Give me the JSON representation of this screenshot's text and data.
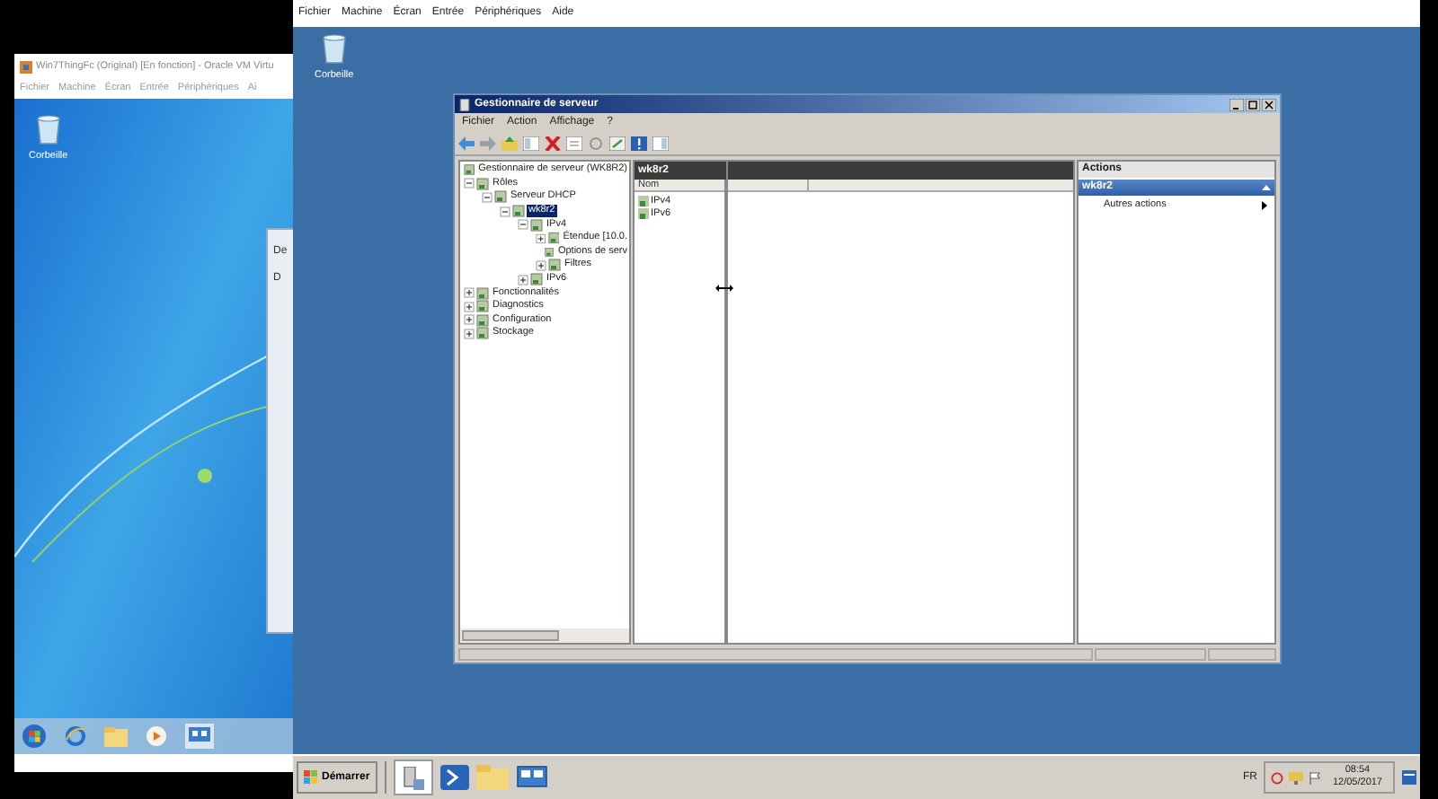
{
  "left_vm": {
    "title": "Win7ThingFc (Original) [En fonction] - Oracle VM Virtu",
    "menu": [
      "Fichier",
      "Machine",
      "Écran",
      "Entrée",
      "Périphériques",
      "Ai"
    ],
    "desktop_icons": [
      {
        "label": "Corbeille"
      }
    ],
    "dialog": {
      "texts": [
        "De",
        "D"
      ]
    }
  },
  "right_vm": {
    "menu": [
      "Fichier",
      "Machine",
      "Écran",
      "Entrée",
      "Périphériques",
      "Aide"
    ],
    "desktop_icons": [
      {
        "label": "Corbeille"
      }
    ],
    "taskbar": {
      "start": "Démarrer",
      "language": "FR",
      "time": "08:54",
      "date": "12/05/2017"
    }
  },
  "server_manager": {
    "title": "Gestionnaire de serveur",
    "menu": [
      "Fichier",
      "Action",
      "Affichage",
      "?"
    ],
    "tree": [
      {
        "label": "Gestionnaire de serveur (WK8R2)",
        "selected": false,
        "children": [
          {
            "label": "Rôles",
            "expanded": true,
            "selected": false,
            "children": [
              {
                "label": "Serveur DHCP",
                "expanded": true,
                "selected": false,
                "children": [
                  {
                    "label": "wk8r2",
                    "expanded": true,
                    "selected": true,
                    "children": [
                      {
                        "label": "IPv4",
                        "expanded": true,
                        "selected": false,
                        "children": [
                          {
                            "label": "Étendue [10.0.",
                            "expanded": false,
                            "selected": false
                          },
                          {
                            "label": "Options de serv",
                            "selected": false
                          },
                          {
                            "label": "Filtres",
                            "expanded": false,
                            "selected": false
                          }
                        ]
                      },
                      {
                        "label": "IPv6",
                        "expanded": false,
                        "selected": false
                      }
                    ]
                  }
                ]
              }
            ]
          },
          {
            "label": "Fonctionnalités",
            "expanded": false,
            "selected": false
          },
          {
            "label": "Diagnostics",
            "expanded": false,
            "selected": false
          },
          {
            "label": "Configuration",
            "expanded": false,
            "selected": false
          },
          {
            "label": "Stockage",
            "expanded": false,
            "selected": false
          }
        ]
      }
    ],
    "content": {
      "header": "wk8r2",
      "columns": [
        "Nom"
      ],
      "rows": [
        "IPv4",
        "IPv6"
      ]
    },
    "actions": {
      "title": "Actions",
      "section": "wk8r2",
      "items": [
        "Autres actions"
      ]
    }
  }
}
